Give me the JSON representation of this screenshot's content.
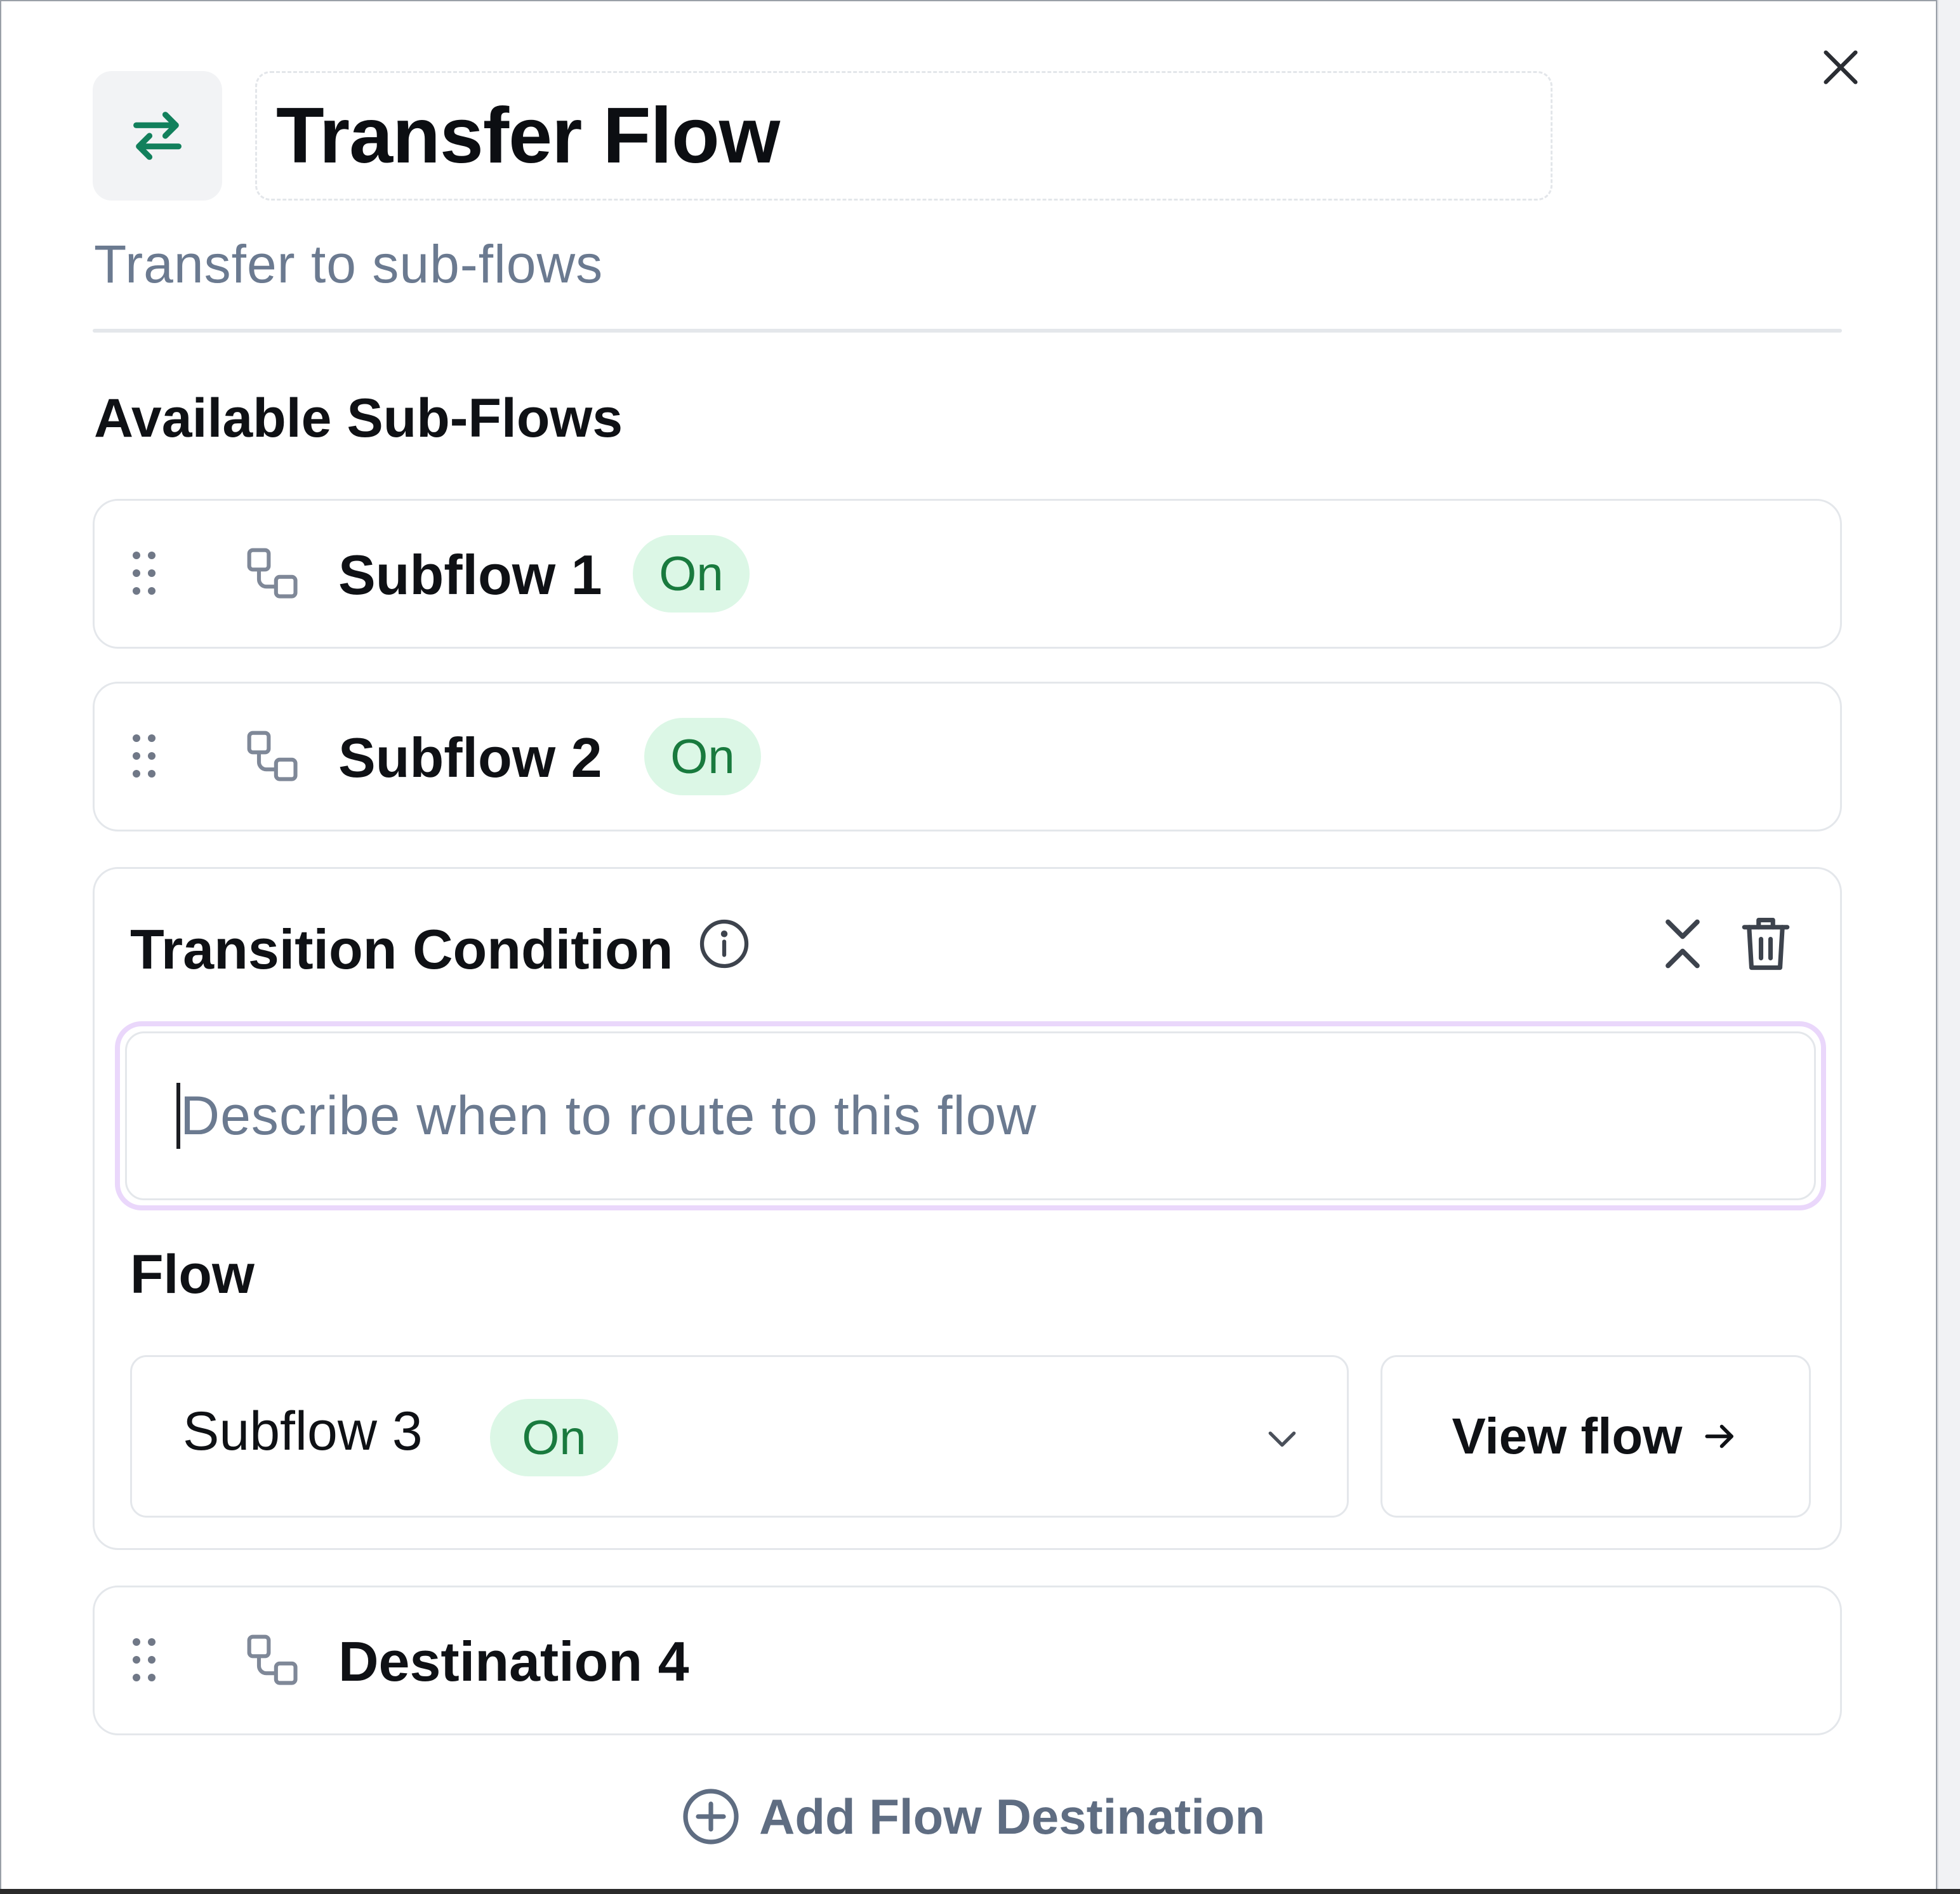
{
  "header": {
    "title": "Transfer Flow",
    "subtitle": "Transfer to sub-flows",
    "icon": "arrows-left-right-icon",
    "accent_color": "#12805c"
  },
  "section": {
    "title": "Available Sub-Flows"
  },
  "subflows": [
    {
      "label": "Subflow 1",
      "status": "On"
    },
    {
      "label": "Subflow 2",
      "status": "On"
    }
  ],
  "condition": {
    "title": "Transition Condition",
    "input_placeholder": "Describe when to route to this flow",
    "flow_label": "Flow",
    "selected_flow": "Subflow 3",
    "selected_flow_status": "On",
    "view_button_label": "View flow"
  },
  "destination": {
    "label": "Destination 4"
  },
  "footer": {
    "add_label": "Add Flow Destination"
  },
  "colors": {
    "badge_bg": "#dcf7e6",
    "badge_text": "#197a3e",
    "focus_ring": "#ead7fb",
    "muted_text": "#6b7a90"
  }
}
